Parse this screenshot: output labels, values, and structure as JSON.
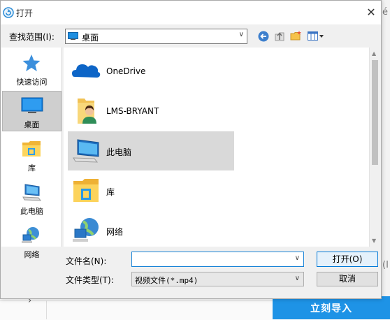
{
  "background": {
    "right_edge_text_top": "é",
    "right_edge_text_mid": "(I",
    "chevron": "›",
    "import_button": "立刻导入"
  },
  "dialog": {
    "title": "打开",
    "close_symbol": "✕",
    "look_in": {
      "label": "查找范围(I):",
      "value": "桌面"
    },
    "places": [
      {
        "label": "快速访问",
        "icon": "star-icon"
      },
      {
        "label": "桌面",
        "icon": "desktop-icon",
        "selected": true
      },
      {
        "label": "库",
        "icon": "library-icon"
      },
      {
        "label": "此电脑",
        "icon": "computer-icon"
      },
      {
        "label": "网络",
        "icon": "network-icon"
      }
    ],
    "items": [
      {
        "label": "OneDrive",
        "icon": "cloud-icon"
      },
      {
        "label": "LMS-BRYANT",
        "icon": "user-folder-icon"
      },
      {
        "label": "此电脑",
        "icon": "computer-icon",
        "highlighted": true
      },
      {
        "label": "库",
        "icon": "library-icon"
      },
      {
        "label": "网络",
        "icon": "network-icon"
      }
    ],
    "file_name": {
      "label": "文件名(N):",
      "value": ""
    },
    "file_type": {
      "label": "文件类型(T):",
      "value": "视频文件(*.mp4)"
    },
    "buttons": {
      "open": "打开(O)",
      "cancel": "取消"
    },
    "colors": {
      "accent": "#0078d7",
      "selection": "#cfcfcf",
      "import_button": "#1e93e6"
    }
  }
}
